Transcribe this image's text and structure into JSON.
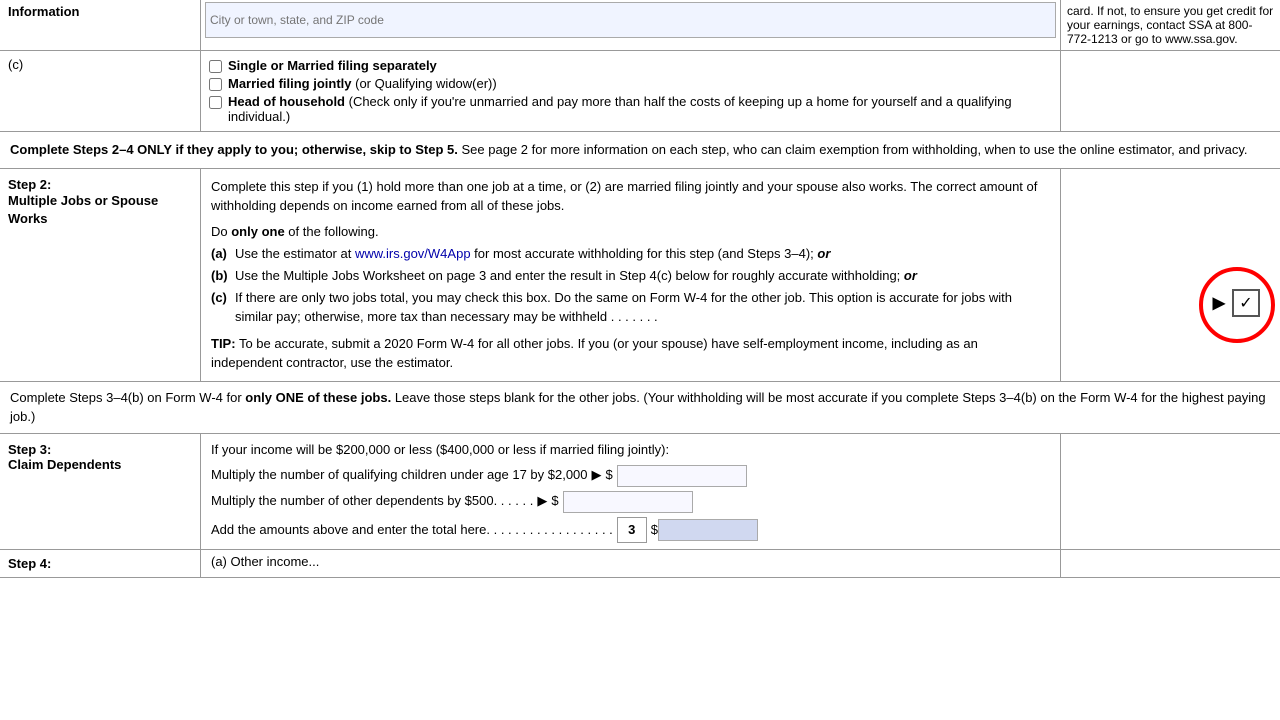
{
  "top": {
    "label": "Information",
    "address_placeholder": "City or town, state, and ZIP code",
    "right_text": "card. If not, to ensure you get credit for your earnings, contact SSA at 800-772-1213 or go to www.ssa.gov."
  },
  "filing": {
    "label_c": "(c)",
    "option1": "Single or Married filing separately",
    "option2_bold": "Married filing jointly",
    "option2_rest": " (or Qualifying widow(er))",
    "option3_bold": "Head of household",
    "option3_rest": " (Check only if you're unmarried and pay more than half the costs of keeping up a home for yourself and a qualifying individual.)"
  },
  "complete_steps_banner": {
    "text": "Complete Steps 2–4 ONLY if they apply to you; otherwise, skip to Step 5.",
    "rest": " See page 2 for more information on each step, who can claim exemption from withholding, when to use the online estimator, and privacy."
  },
  "step2": {
    "number": "Step 2:",
    "title": "Multiple Jobs or Spouse Works",
    "intro": "Complete this step if you (1) hold more than one job at a time, or (2) are married filing jointly and your spouse also works. The correct amount of withholding depends on income earned from all of these jobs.",
    "do_only_one": "Do ",
    "only_one_bold": "only one",
    "do_only_one_rest": " of the following.",
    "option_a_letter": "(a)",
    "option_a_text": "Use the estimator at ",
    "option_a_url": "www.irs.gov/W4App",
    "option_a_rest": " for most accurate withholding for this step (and Steps 3–4); ",
    "option_a_or": "or",
    "option_b_letter": "(b)",
    "option_b_text": "Use the Multiple Jobs Worksheet on page 3 and enter the result in Step 4(c) below for roughly accurate withholding; ",
    "option_b_or": "or",
    "option_c_letter": "(c)",
    "option_c_text": "If there are only two jobs total, you may check this box. Do the same on Form W-4 for the other job. This option is accurate for jobs with similar pay; otherwise, more tax than necessary may be withheld . . . . . . .",
    "tip_bold": "TIP:",
    "tip_text": " To be accurate, submit a 2020 Form W-4 for all other jobs. If you (or your spouse) have self-employment income, including as an independent contractor, use the estimator."
  },
  "complete_steps_34": {
    "text1": "Complete Steps 3–4(b) on Form W-4 for ",
    "text1_bold": "only ONE of these jobs.",
    "text2": " Leave those steps blank for the other jobs. (Your withholding will be most accurate if you complete Steps 3–4(b) on the Form W-4 for the highest paying job.)"
  },
  "step3": {
    "number": "Step 3:",
    "title": "Claim Dependents",
    "intro": "If your income will be $200,000 or less ($400,000 or less if married filing jointly):",
    "row1_text": "Multiply the number of qualifying children under age 17 by $2,000",
    "row1_arrow": "▶",
    "row1_dollar": "$",
    "row2_text": "Multiply the number of other dependents by $500",
    "row2_dots": " . . . . . .",
    "row2_arrow": "▶",
    "row2_dollar": "$",
    "total_text": "Add the amounts above and enter the total here",
    "total_dots": " . . . . . . . . . . . . . . . . . .",
    "total_box_num": "3",
    "total_dollar": "$"
  },
  "step4_partial": {
    "number": "Step 4:",
    "text": "(a) Other income..."
  },
  "checkbox_symbol": "✓"
}
